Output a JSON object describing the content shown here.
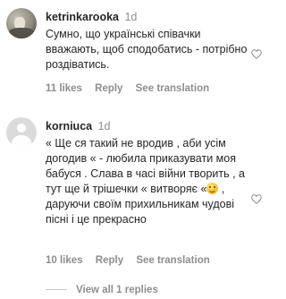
{
  "comments": [
    {
      "username": "ketrinkarooka",
      "time": "1d",
      "text": "Сумно, що українські співачки вважають, щоб сподобатись - потрібно роздіватись.",
      "likes": "11 likes",
      "reply": "Reply",
      "translate": "See translation",
      "avatar": "user-photo"
    },
    {
      "username": "korniuca",
      "time": "1d",
      "text_before_emoji": "« Ще ся такий не вродив , аби усім догодив « - любила приказувати моя бабуся . Слава в часі війни творить , а тут ще й трішечки « витворяє «",
      "text_after_emoji": " , даруючи своїм прихильникам чудові пісні і це прекрасно",
      "emoji": "smiling-face",
      "likes": "10 likes",
      "reply": "Reply",
      "translate": "See translation",
      "avatar": "default-profile"
    }
  ],
  "view_replies": "View all 1 replies",
  "icons": {
    "like": "heart-outline-icon"
  },
  "colors": {
    "text": "#262626",
    "secondary": "#8e8e8e"
  }
}
